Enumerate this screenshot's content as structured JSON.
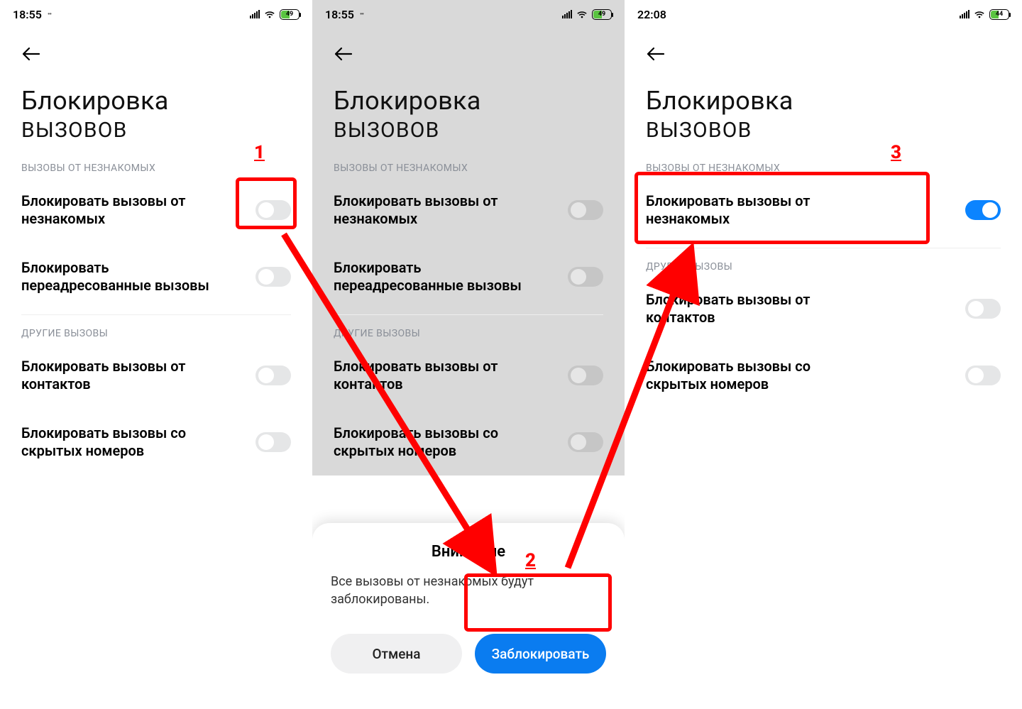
{
  "annotations": {
    "num1": "1",
    "num2": "2",
    "num3": "3"
  },
  "colors": {
    "accent": "#0b84ff",
    "primary_btn": "#0a7cf0",
    "highlight": "#ff0000"
  },
  "screens": [
    {
      "status": {
        "time": "18:55",
        "battery_pct": "49"
      },
      "title_l1": "Блокировка",
      "title_l2": "вызовов",
      "section1_label": "ВЫЗОВЫ ОТ НЕЗНАКОМЫХ",
      "opt1": "Блокировать вызовы от незнакомых",
      "opt2": "Блокировать переадресованные вызовы",
      "section2_label": "ДРУГИЕ ВЫЗОВЫ",
      "opt3": "Блокировать вызовы от контактов",
      "opt4": "Блокировать вызовы со скрытых номеров",
      "opt1_on": false,
      "opt2_on": false,
      "opt3_on": false,
      "opt4_on": false
    },
    {
      "status": {
        "time": "18:55",
        "battery_pct": "49"
      },
      "title_l1": "Блокировка",
      "title_l2": "вызовов",
      "section1_label": "ВЫЗОВЫ ОТ НЕЗНАКОМЫХ",
      "opt1": "Блокировать вызовы от незнакомых",
      "opt2": "Блокировать переадресованные вызовы",
      "section2_label": "ДРУГИЕ ВЫЗОВЫ",
      "opt3": "Блокировать вызовы от контактов",
      "opt4": "Блокировать вызовы со скрытых номеров",
      "opt1_on": false,
      "opt2_on": false,
      "opt3_on": false,
      "opt4_on": false,
      "dialog": {
        "title": "Внимание",
        "text": "Все вызовы от незнакомых будут заблокированы.",
        "cancel": "Отмена",
        "confirm": "Заблокировать"
      }
    },
    {
      "status": {
        "time": "22:08",
        "battery_pct": "44"
      },
      "title_l1": "Блокировка",
      "title_l2": "вызовов",
      "section1_label": "ВЫЗОВЫ ОТ НЕЗНАКОМЫХ",
      "opt1": "Блокировать вызовы от незнакомых",
      "section2_label": "ДРУГИЕ ВЫЗОВЫ",
      "opt3": "Блокировать вызовы от контактов",
      "opt4": "Блокировать вызовы со скрытых номеров",
      "opt1_on": true,
      "opt3_on": false,
      "opt4_on": false
    }
  ]
}
